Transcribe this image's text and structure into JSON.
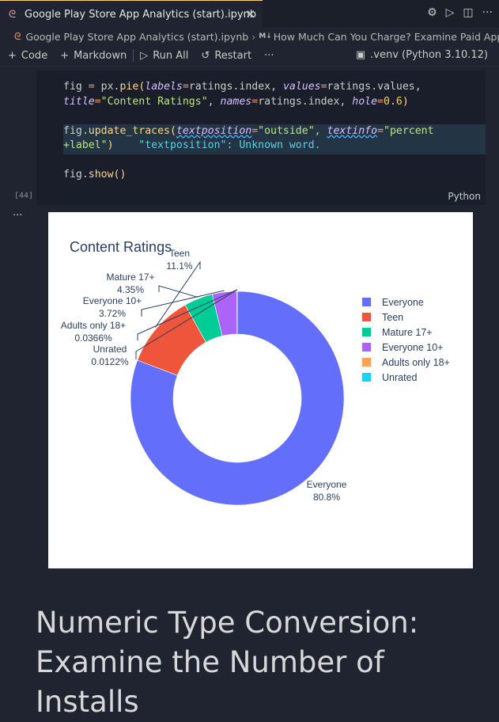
{
  "tab": {
    "title": "Google Play Store App Analytics (start).ipynb"
  },
  "breadcrumb": {
    "file": "Google Play Store App Analytics (start).ipynb",
    "section_badge": "M↓",
    "section": "How Much Can You Charge? Examine Paid App P"
  },
  "toolbar": {
    "code": "Code",
    "markdown": "Markdown",
    "run_all": "Run All",
    "restart": "Restart",
    "more": "···",
    "kernel": ".venv (Python 3.10.12)"
  },
  "cell": {
    "exec_count": "[44]",
    "language": "Python",
    "diagnostic": "\"textposition\": Unknown word."
  },
  "output": {
    "more": "···"
  },
  "chart_data": {
    "type": "pie",
    "title": "Content Ratings",
    "hole": 0.6,
    "categories": [
      "Everyone",
      "Teen",
      "Mature 17+",
      "Everyone 10+",
      "Adults only 18+",
      "Unrated"
    ],
    "values": [
      80.8,
      11.1,
      4.35,
      3.72,
      0.0366,
      0.0122
    ],
    "labels": [
      "80.8%",
      "11.1%",
      "4.35%",
      "3.72%",
      "0.0366%",
      "0.0122%"
    ],
    "colors": [
      "#636efa",
      "#ef553b",
      "#00cc96",
      "#ab63fa",
      "#ffa15a",
      "#19d3f3"
    ],
    "legend_position": "right"
  },
  "markdown": {
    "heading": "Numeric Type Conversion: Examine the Number of Installs"
  }
}
